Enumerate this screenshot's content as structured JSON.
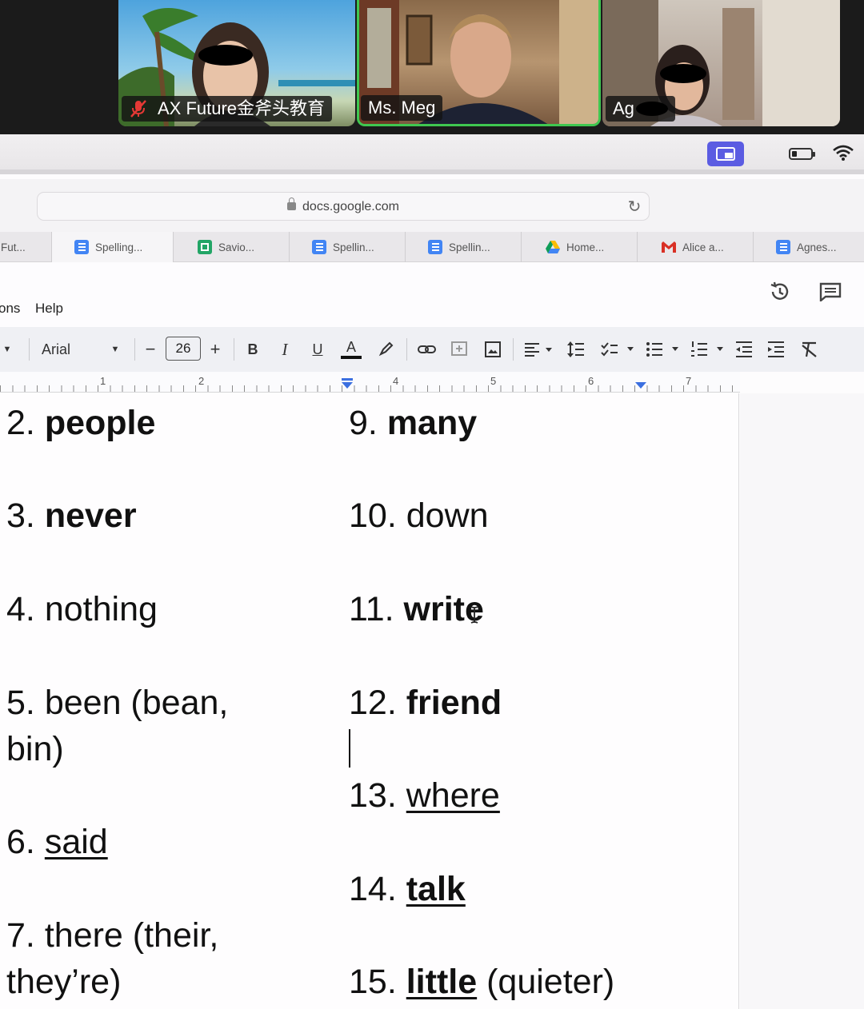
{
  "zoom": {
    "participants": [
      {
        "name": "AX Future金斧头教育",
        "muted": true,
        "speaking": false
      },
      {
        "name": "Ms. Meg",
        "muted": false,
        "speaking": true
      },
      {
        "name": "Ag",
        "muted": false,
        "speaking": false
      }
    ]
  },
  "browser": {
    "url": "docs.google.com",
    "tabs": [
      {
        "label": "Fut...",
        "icon": "docs-icon"
      },
      {
        "label": "Spelling...",
        "icon": "docs-icon",
        "active": true
      },
      {
        "label": "Savio...",
        "icon": "sheets-icon"
      },
      {
        "label": "Spellin...",
        "icon": "docs-icon"
      },
      {
        "label": "Spellin...",
        "icon": "docs-icon"
      },
      {
        "label": "Home...",
        "icon": "drive-icon"
      },
      {
        "label": "Alice a...",
        "icon": "gmail-icon"
      },
      {
        "label": "Agnes...",
        "icon": "docs-icon"
      }
    ]
  },
  "docs": {
    "menu": {
      "partial": "ons",
      "help": "Help"
    },
    "toolbar": {
      "font": "Arial",
      "font_size": "26",
      "minus": "−",
      "plus": "+",
      "bold": "B",
      "italic": "I",
      "underline": "U",
      "text_color": "A"
    },
    "ruler": {
      "numbers": [
        "1",
        "2",
        "4",
        "5",
        "6",
        "7"
      ]
    },
    "words_left": [
      {
        "num": "2.",
        "word": "people",
        "rest": ""
      },
      {
        "num": "3.",
        "word": "never",
        "rest": ""
      },
      {
        "num": "4.",
        "word": "nothing",
        "rest": ""
      },
      {
        "num": "5.",
        "word": "been (bean,",
        "rest": "bin)"
      },
      {
        "num": "6.",
        "word": "said",
        "rest": ""
      },
      {
        "num": "7.",
        "word": "there (their,",
        "rest": "they’re)"
      }
    ],
    "words_right": [
      {
        "num": "9.",
        "word": "many",
        "rest": ""
      },
      {
        "num": "10.",
        "word": "down",
        "rest": ""
      },
      {
        "num": "11.",
        "word": "write",
        "rest": ""
      },
      {
        "num": "12.",
        "word": "friend",
        "rest": ""
      },
      {
        "num": "13.",
        "word": "where",
        "rest": ""
      },
      {
        "num": "14.",
        "word": "talk",
        "rest": ""
      },
      {
        "num": "15.",
        "word": "little",
        "rest": "(quieter)"
      }
    ]
  },
  "colors": {
    "zoom_active": "#3fc750",
    "screen_share": "#5b5ce2",
    "docs_blue": "#4285f4"
  }
}
